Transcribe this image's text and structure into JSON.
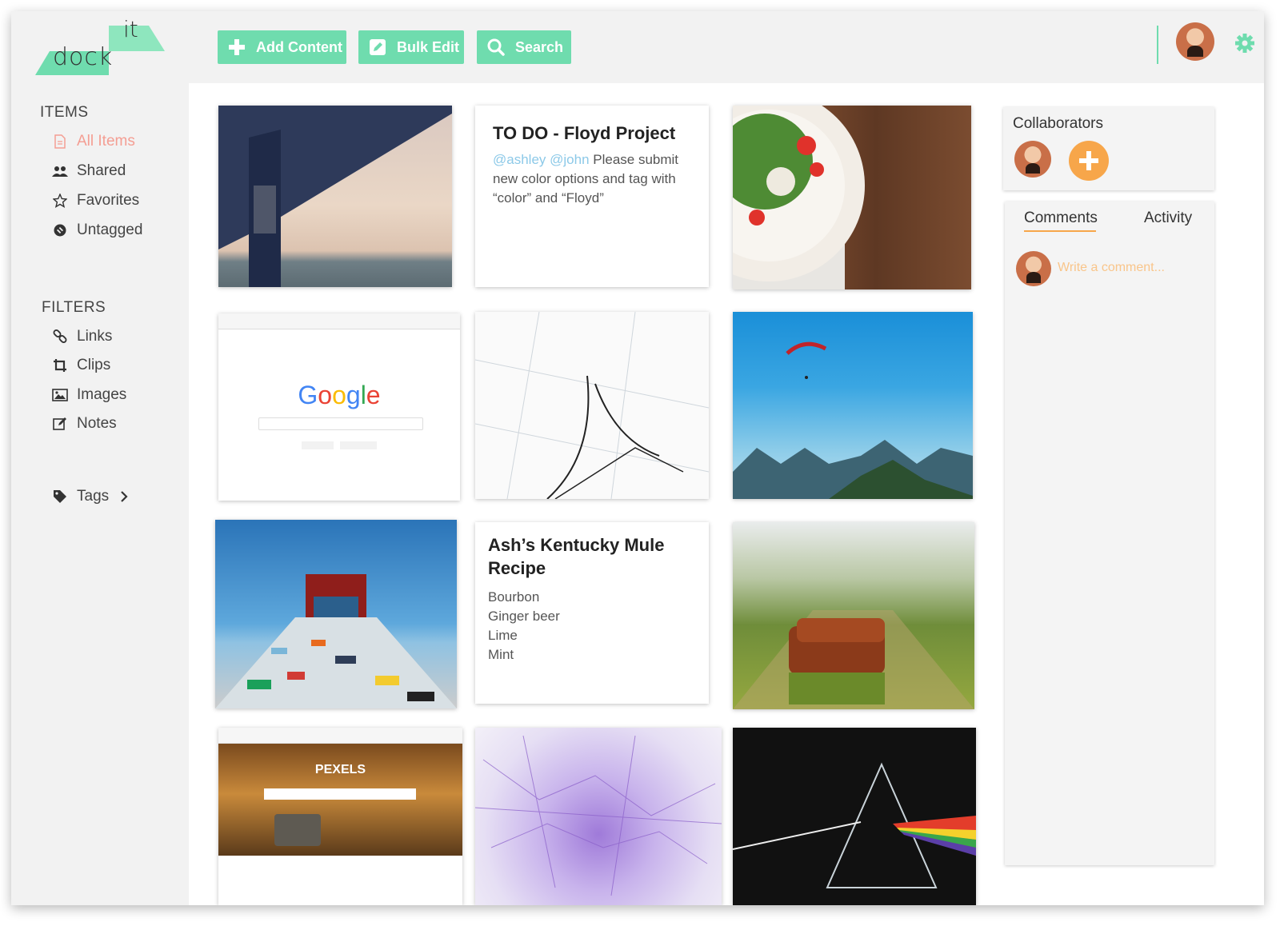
{
  "app": {
    "logo_top": "it",
    "logo_bottom": "dock"
  },
  "toolbar": {
    "add_label": "Add Content",
    "bulk_label": "Bulk Edit",
    "search_label": "Search"
  },
  "sidebar": {
    "items_title": "ITEMS",
    "items": [
      {
        "label": "All Items",
        "icon": "document-icon",
        "active": true
      },
      {
        "label": "Shared",
        "icon": "users-icon"
      },
      {
        "label": "Favorites",
        "icon": "star-icon"
      },
      {
        "label": "Untagged",
        "icon": "untagged-icon"
      }
    ],
    "filters_title": "FILTERS",
    "filters": [
      {
        "label": "Links",
        "icon": "link-icon"
      },
      {
        "label": "Clips",
        "icon": "crop-icon"
      },
      {
        "label": "Images",
        "icon": "image-icon"
      },
      {
        "label": "Notes",
        "icon": "edit-icon"
      }
    ],
    "tags_label": "Tags"
  },
  "cards": {
    "todo": {
      "title": "TO DO - Floyd Project",
      "mentions": "@ashley @john",
      "body": " Please submit new color options and tag with “color” and “Floyd”"
    },
    "google": {
      "logo": "Google"
    },
    "pexels": {
      "title": "PEXELS"
    },
    "recipe": {
      "title": "Ash’s Kentucky Mule Recipe",
      "ingredients": [
        "Bourbon",
        "Ginger beer",
        "Lime",
        "Mint"
      ]
    }
  },
  "right_panel": {
    "collaborators_title": "Collaborators",
    "tabs": {
      "comments": "Comments",
      "activity": "Activity"
    },
    "comment_placeholder": "Write a comment..."
  },
  "colors": {
    "accent": "#6fdcae",
    "active": "#f49e93",
    "orange": "#f7a64a"
  }
}
